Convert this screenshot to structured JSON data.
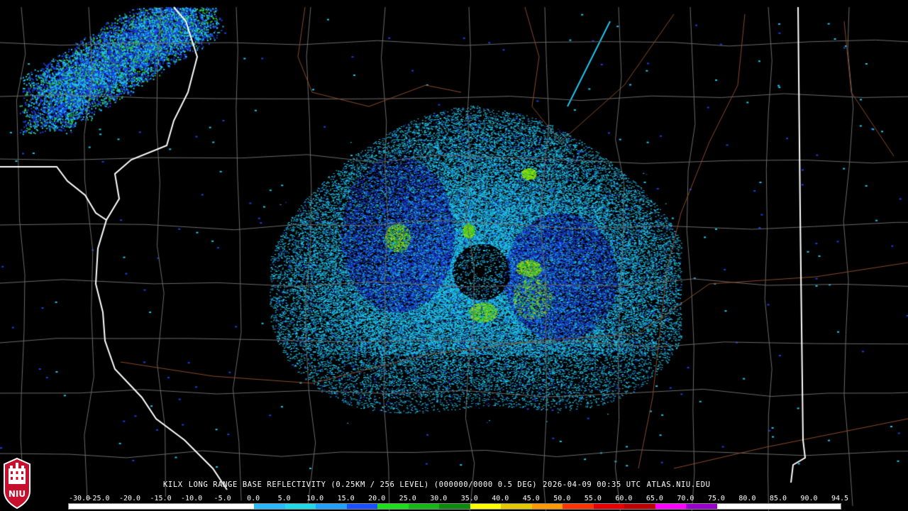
{
  "caption": {
    "station": "KILX",
    "product": "LONG RANGE BASE REFLECTIVITY (0.25KM / 256 LEVEL) (000000/0000 0.5 DEG)",
    "datetime": "2026-04-09 00:35 UTC",
    "source": "ATLAS.NIU.EDU"
  },
  "logo": {
    "text": "NIU"
  },
  "scale": {
    "labels": [
      "-30.0",
      "-25.0",
      "-20.0",
      "-15.0",
      "-10.0",
      "-5.0",
      "0.0",
      "5.0",
      "10.0",
      "15.0",
      "20.0",
      "25.0",
      "30.0",
      "35.0",
      "40.0",
      "45.0",
      "50.0",
      "55.0",
      "60.0",
      "65.0",
      "70.0",
      "75.0",
      "80.0",
      "85.0",
      "90.0",
      "94.5"
    ],
    "colors": [
      "#ffffff",
      "#ffffff",
      "#ffffff",
      "#ffffff",
      "#ffffff",
      "#ffffff",
      "#2ab8ff",
      "#1fd9e8",
      "#20a0ff",
      "#1a50ff",
      "#1adf1a",
      "#14b814",
      "#0f8a0f",
      "#ffff00",
      "#e6c800",
      "#ff9900",
      "#ff3300",
      "#e60000",
      "#c00000",
      "#ff00ff",
      "#9900cc",
      "#ffffff",
      "#ffffff",
      "#ffffff",
      "#ffffff"
    ]
  },
  "colors": {
    "background": "#000000",
    "county_lines": "#6a6a6a",
    "state_lines": "#ffffff",
    "rivers": "#8a4a2a",
    "echo_light": "#22c8f0",
    "echo_medium": "#1a40e0",
    "echo_strong": "#30c030"
  }
}
